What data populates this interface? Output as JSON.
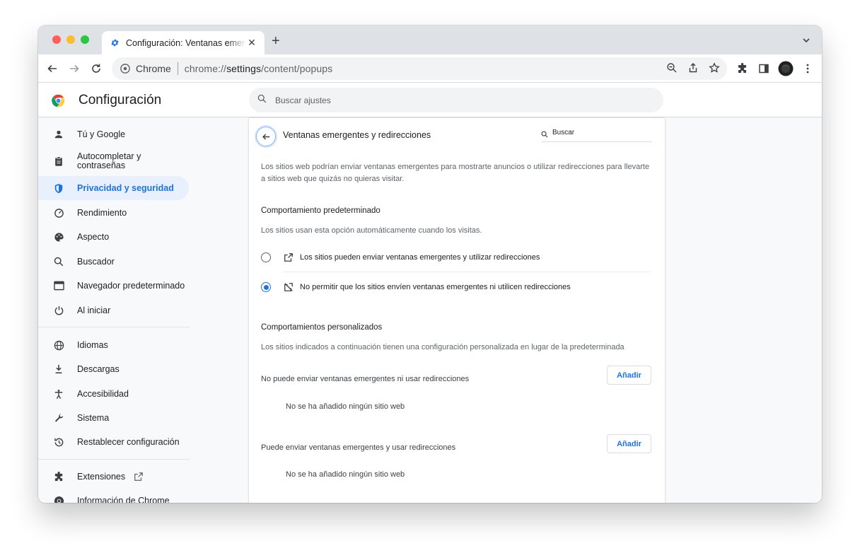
{
  "browser": {
    "tab_title": "Configuración: Ventanas emergentes y redirecciones",
    "omnibox_chip": "Chrome",
    "url_prefix": "chrome://",
    "url_host": "settings",
    "url_path": "/content/popups"
  },
  "header": {
    "title": "Configuración",
    "search_placeholder": "Buscar ajustes"
  },
  "sidebar": {
    "items": [
      {
        "label": "Tú y Google",
        "icon": "person-icon"
      },
      {
        "label": "Autocompletar y contraseñas",
        "icon": "clipboard-icon"
      },
      {
        "label": "Privacidad y seguridad",
        "icon": "shield-icon",
        "active": true
      },
      {
        "label": "Rendimiento",
        "icon": "speedometer-icon"
      },
      {
        "label": "Aspecto",
        "icon": "palette-icon"
      },
      {
        "label": "Buscador",
        "icon": "search-icon"
      },
      {
        "label": "Navegador predeterminado",
        "icon": "browser-icon"
      },
      {
        "label": "Al iniciar",
        "icon": "power-icon"
      },
      {
        "label": "Idiomas",
        "icon": "globe-icon"
      },
      {
        "label": "Descargas",
        "icon": "download-icon"
      },
      {
        "label": "Accesibilidad",
        "icon": "accessibility-icon"
      },
      {
        "label": "Sistema",
        "icon": "wrench-icon"
      },
      {
        "label": "Restablecer configuración",
        "icon": "restore-icon"
      },
      {
        "label": "Extensiones",
        "icon": "puzzle-icon"
      },
      {
        "label": "Información de Chrome",
        "icon": "chrome-icon"
      }
    ]
  },
  "page": {
    "title": "Ventanas emergentes y redirecciones",
    "search_placeholder": "Buscar",
    "description": "Los sitios web podrían enviar ventanas emergentes para mostrarte anuncios o utilizar redirecciones para llevarte a sitios web que quizás no quieras visitar.",
    "default_heading": "Comportamiento predeterminado",
    "default_sub": "Los sitios usan esta opción automáticamente cuando los visitas.",
    "option_allow": "Los sitios pueden enviar ventanas emergentes y utilizar redirecciones",
    "option_block": "No permitir que los sitios envíen ventanas emergentes ni utilicen redirecciones",
    "selected_option": "block",
    "custom_heading": "Comportamientos personalizados",
    "custom_sub": "Los sitios indicados a continuación tienen una configuración personalizada en lugar de la predeterminada",
    "block_list_label": "No puede enviar ventanas emergentes ni usar redirecciones",
    "allow_list_label": "Puede enviar ventanas emergentes y usar redirecciones",
    "add_label": "Añadir",
    "empty_label": "No se ha añadido ningún sitio web"
  },
  "colors": {
    "accent": "#1a73e8",
    "active_nav_bg": "#e8f0fe"
  }
}
